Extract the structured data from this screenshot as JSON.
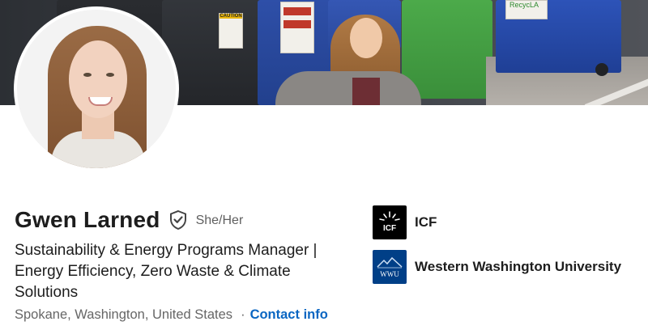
{
  "profile": {
    "name": "Gwen Larned",
    "pronouns": "She/Her",
    "headline": "Sustainability & Energy Programs Manager | Energy Efficiency, Zero Waste & Climate Solutions",
    "location": "Spokane, Washington, United States",
    "separator": "·",
    "contact_label": "Contact info"
  },
  "experience": [
    {
      "name": "ICF",
      "logo_text": "ICF",
      "logo_color": "#000000",
      "icon": "icf-logo-icon"
    },
    {
      "name": "Western Washington University",
      "logo_text": "WWU",
      "logo_color": "#003f87",
      "icon": "wwu-logo-icon"
    }
  ],
  "cover": {
    "signs": [
      "CAUTION",
      "RecycLA"
    ]
  },
  "colors": {
    "link": "#0a66c2",
    "text": "#1d1d1d",
    "muted": "#666666"
  }
}
